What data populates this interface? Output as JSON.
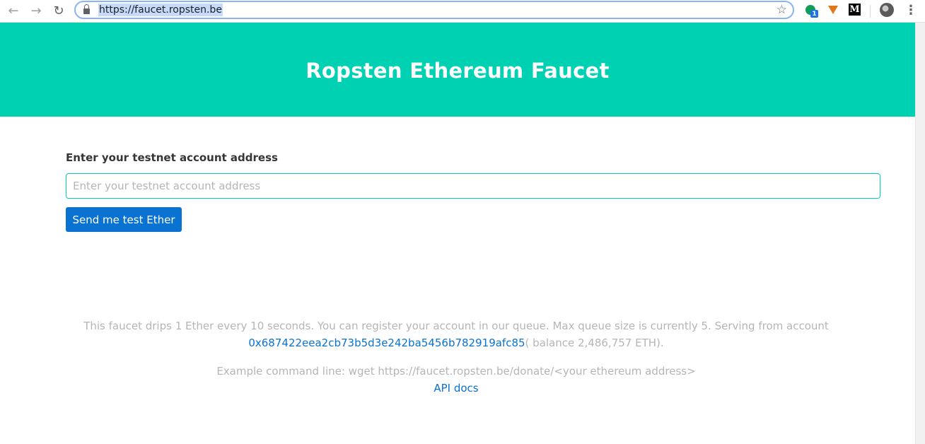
{
  "browser": {
    "url": "https://faucet.ropsten.be",
    "extension_badge": "1",
    "medium_letter": "M",
    "icons": {
      "back": "back-arrow-icon",
      "forward": "forward-arrow-icon",
      "reload": "reload-icon",
      "lock": "lock-icon",
      "bookmark": "star-icon",
      "menu": "more-vert-icon"
    }
  },
  "header": {
    "title": "Ropsten Ethereum Faucet",
    "background_color": "#00d1b2"
  },
  "form": {
    "label": "Enter your testnet account address",
    "input_value": "",
    "input_placeholder": "Enter your testnet account address",
    "button_label": "Send me test Ether",
    "button_color": "#0a72d0"
  },
  "footer": {
    "drip_text": "This faucet drips 1 Ether every 10 seconds. You can register your account in our queue. Max queue size is currently 5. Serving from account",
    "account_address": "0x687422eea2cb73b5d3e242ba5456b782919afc85",
    "balance_text": "( balance 2,486,757 ETH).",
    "example_text": "Example command line: wget https://faucet.ropsten.be/donate/<your ethereum address>",
    "api_docs_label": "API docs"
  }
}
